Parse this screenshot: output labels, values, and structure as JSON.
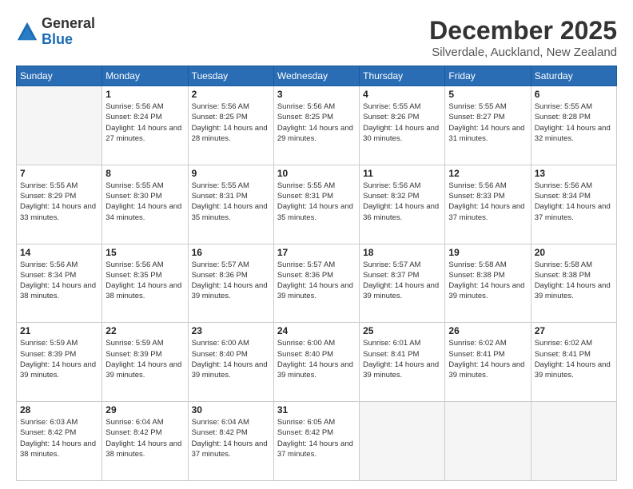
{
  "header": {
    "logo_general": "General",
    "logo_blue": "Blue",
    "month_year": "December 2025",
    "location": "Silverdale, Auckland, New Zealand"
  },
  "days_of_week": [
    "Sunday",
    "Monday",
    "Tuesday",
    "Wednesday",
    "Thursday",
    "Friday",
    "Saturday"
  ],
  "weeks": [
    [
      {
        "num": "",
        "sunrise": "",
        "sunset": "",
        "daylight": ""
      },
      {
        "num": "1",
        "sunrise": "Sunrise: 5:56 AM",
        "sunset": "Sunset: 8:24 PM",
        "daylight": "Daylight: 14 hours and 27 minutes."
      },
      {
        "num": "2",
        "sunrise": "Sunrise: 5:56 AM",
        "sunset": "Sunset: 8:25 PM",
        "daylight": "Daylight: 14 hours and 28 minutes."
      },
      {
        "num": "3",
        "sunrise": "Sunrise: 5:56 AM",
        "sunset": "Sunset: 8:25 PM",
        "daylight": "Daylight: 14 hours and 29 minutes."
      },
      {
        "num": "4",
        "sunrise": "Sunrise: 5:55 AM",
        "sunset": "Sunset: 8:26 PM",
        "daylight": "Daylight: 14 hours and 30 minutes."
      },
      {
        "num": "5",
        "sunrise": "Sunrise: 5:55 AM",
        "sunset": "Sunset: 8:27 PM",
        "daylight": "Daylight: 14 hours and 31 minutes."
      },
      {
        "num": "6",
        "sunrise": "Sunrise: 5:55 AM",
        "sunset": "Sunset: 8:28 PM",
        "daylight": "Daylight: 14 hours and 32 minutes."
      }
    ],
    [
      {
        "num": "7",
        "sunrise": "Sunrise: 5:55 AM",
        "sunset": "Sunset: 8:29 PM",
        "daylight": "Daylight: 14 hours and 33 minutes."
      },
      {
        "num": "8",
        "sunrise": "Sunrise: 5:55 AM",
        "sunset": "Sunset: 8:30 PM",
        "daylight": "Daylight: 14 hours and 34 minutes."
      },
      {
        "num": "9",
        "sunrise": "Sunrise: 5:55 AM",
        "sunset": "Sunset: 8:31 PM",
        "daylight": "Daylight: 14 hours and 35 minutes."
      },
      {
        "num": "10",
        "sunrise": "Sunrise: 5:55 AM",
        "sunset": "Sunset: 8:31 PM",
        "daylight": "Daylight: 14 hours and 35 minutes."
      },
      {
        "num": "11",
        "sunrise": "Sunrise: 5:56 AM",
        "sunset": "Sunset: 8:32 PM",
        "daylight": "Daylight: 14 hours and 36 minutes."
      },
      {
        "num": "12",
        "sunrise": "Sunrise: 5:56 AM",
        "sunset": "Sunset: 8:33 PM",
        "daylight": "Daylight: 14 hours and 37 minutes."
      },
      {
        "num": "13",
        "sunrise": "Sunrise: 5:56 AM",
        "sunset": "Sunset: 8:34 PM",
        "daylight": "Daylight: 14 hours and 37 minutes."
      }
    ],
    [
      {
        "num": "14",
        "sunrise": "Sunrise: 5:56 AM",
        "sunset": "Sunset: 8:34 PM",
        "daylight": "Daylight: 14 hours and 38 minutes."
      },
      {
        "num": "15",
        "sunrise": "Sunrise: 5:56 AM",
        "sunset": "Sunset: 8:35 PM",
        "daylight": "Daylight: 14 hours and 38 minutes."
      },
      {
        "num": "16",
        "sunrise": "Sunrise: 5:57 AM",
        "sunset": "Sunset: 8:36 PM",
        "daylight": "Daylight: 14 hours and 39 minutes."
      },
      {
        "num": "17",
        "sunrise": "Sunrise: 5:57 AM",
        "sunset": "Sunset: 8:36 PM",
        "daylight": "Daylight: 14 hours and 39 minutes."
      },
      {
        "num": "18",
        "sunrise": "Sunrise: 5:57 AM",
        "sunset": "Sunset: 8:37 PM",
        "daylight": "Daylight: 14 hours and 39 minutes."
      },
      {
        "num": "19",
        "sunrise": "Sunrise: 5:58 AM",
        "sunset": "Sunset: 8:38 PM",
        "daylight": "Daylight: 14 hours and 39 minutes."
      },
      {
        "num": "20",
        "sunrise": "Sunrise: 5:58 AM",
        "sunset": "Sunset: 8:38 PM",
        "daylight": "Daylight: 14 hours and 39 minutes."
      }
    ],
    [
      {
        "num": "21",
        "sunrise": "Sunrise: 5:59 AM",
        "sunset": "Sunset: 8:39 PM",
        "daylight": "Daylight: 14 hours and 39 minutes."
      },
      {
        "num": "22",
        "sunrise": "Sunrise: 5:59 AM",
        "sunset": "Sunset: 8:39 PM",
        "daylight": "Daylight: 14 hours and 39 minutes."
      },
      {
        "num": "23",
        "sunrise": "Sunrise: 6:00 AM",
        "sunset": "Sunset: 8:40 PM",
        "daylight": "Daylight: 14 hours and 39 minutes."
      },
      {
        "num": "24",
        "sunrise": "Sunrise: 6:00 AM",
        "sunset": "Sunset: 8:40 PM",
        "daylight": "Daylight: 14 hours and 39 minutes."
      },
      {
        "num": "25",
        "sunrise": "Sunrise: 6:01 AM",
        "sunset": "Sunset: 8:41 PM",
        "daylight": "Daylight: 14 hours and 39 minutes."
      },
      {
        "num": "26",
        "sunrise": "Sunrise: 6:02 AM",
        "sunset": "Sunset: 8:41 PM",
        "daylight": "Daylight: 14 hours and 39 minutes."
      },
      {
        "num": "27",
        "sunrise": "Sunrise: 6:02 AM",
        "sunset": "Sunset: 8:41 PM",
        "daylight": "Daylight: 14 hours and 39 minutes."
      }
    ],
    [
      {
        "num": "28",
        "sunrise": "Sunrise: 6:03 AM",
        "sunset": "Sunset: 8:42 PM",
        "daylight": "Daylight: 14 hours and 38 minutes."
      },
      {
        "num": "29",
        "sunrise": "Sunrise: 6:04 AM",
        "sunset": "Sunset: 8:42 PM",
        "daylight": "Daylight: 14 hours and 38 minutes."
      },
      {
        "num": "30",
        "sunrise": "Sunrise: 6:04 AM",
        "sunset": "Sunset: 8:42 PM",
        "daylight": "Daylight: 14 hours and 37 minutes."
      },
      {
        "num": "31",
        "sunrise": "Sunrise: 6:05 AM",
        "sunset": "Sunset: 8:42 PM",
        "daylight": "Daylight: 14 hours and 37 minutes."
      },
      {
        "num": "",
        "sunrise": "",
        "sunset": "",
        "daylight": ""
      },
      {
        "num": "",
        "sunrise": "",
        "sunset": "",
        "daylight": ""
      },
      {
        "num": "",
        "sunrise": "",
        "sunset": "",
        "daylight": ""
      }
    ]
  ]
}
